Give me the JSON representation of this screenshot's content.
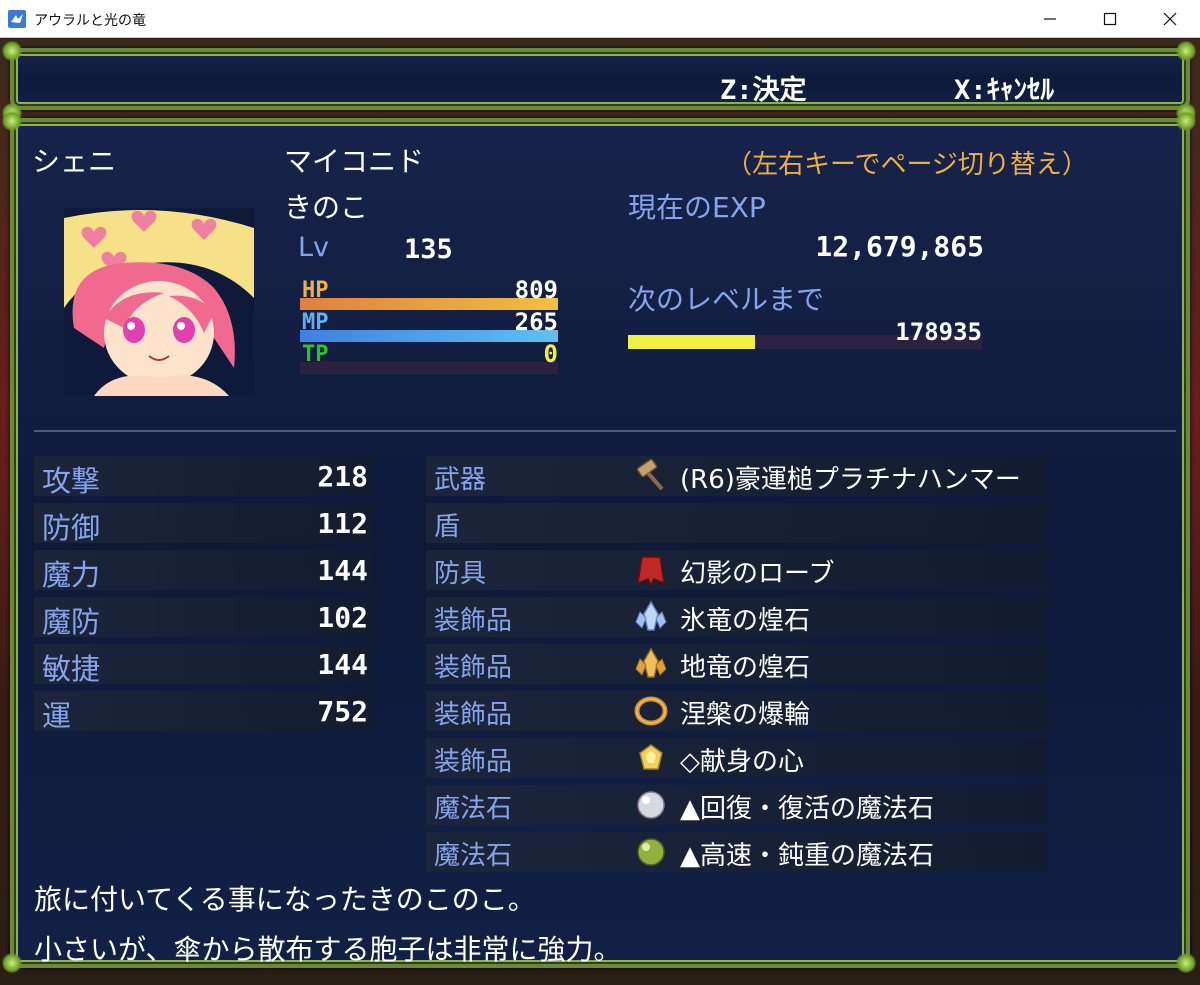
{
  "window": {
    "title": "アウラルと光の竜"
  },
  "help": {
    "confirm": "Z:決定",
    "cancel": "X:ｷｬﾝｾﾙ"
  },
  "actor": {
    "name": "シェニ",
    "class": "マイコニド",
    "nickname": "きのこ",
    "level_label": "Lv",
    "level": "135",
    "hp_label": "HP",
    "hp": "809",
    "hp_rate": 1.0,
    "mp_label": "MP",
    "mp": "265",
    "mp_rate": 1.0,
    "tp_label": "TP",
    "tp": "0",
    "tp_rate": 0.0
  },
  "page_hint": "（左右キーでページ切り替え）",
  "exp": {
    "current_label": "現在のEXP",
    "current": "12,679,865",
    "next_label": "次のレベルまで",
    "next": "178935",
    "progress": 0.36
  },
  "params": [
    {
      "label": "攻撃",
      "value": "218"
    },
    {
      "label": "防御",
      "value": "112"
    },
    {
      "label": "魔力",
      "value": "144"
    },
    {
      "label": "魔防",
      "value": "102"
    },
    {
      "label": "敏捷",
      "value": "144"
    },
    {
      "label": "運",
      "value": "752"
    }
  ],
  "equips": [
    {
      "slot": "武器",
      "item": "(R6)豪運槌プラチナハンマー",
      "icon": "hammer-icon"
    },
    {
      "slot": "盾",
      "item": "",
      "icon": ""
    },
    {
      "slot": "防具",
      "item": "幻影のローブ",
      "icon": "robe-icon"
    },
    {
      "slot": "装飾品",
      "item": "氷竜の煌石",
      "icon": "ice-crystal-icon"
    },
    {
      "slot": "装飾品",
      "item": "地竜の煌石",
      "icon": "earth-crystal-icon"
    },
    {
      "slot": "装飾品",
      "item": "涅槃の爆輪",
      "icon": "ring-icon"
    },
    {
      "slot": "装飾品",
      "item": "◇献身の心",
      "icon": "gem-icon"
    },
    {
      "slot": "魔法石",
      "item": "▲回復・復活の魔法石",
      "icon": "white-orb-icon"
    },
    {
      "slot": "魔法石",
      "item": "▲高速・鈍重の魔法石",
      "icon": "green-orb-icon"
    }
  ],
  "description": [
    "旅に付いてくる事になったきのこのこ。",
    "小さいが、傘から散布する胞子は非常に強力。"
  ],
  "colors": {
    "system": "#84a4ec",
    "hp_gauge": [
      "#e08040",
      "#f0c040"
    ],
    "mp_gauge": [
      "#4080e0",
      "#60c0f0"
    ],
    "tp_gauge": [
      "#20a020",
      "#a0e040"
    ],
    "exp_gauge": "#f0f040"
  }
}
